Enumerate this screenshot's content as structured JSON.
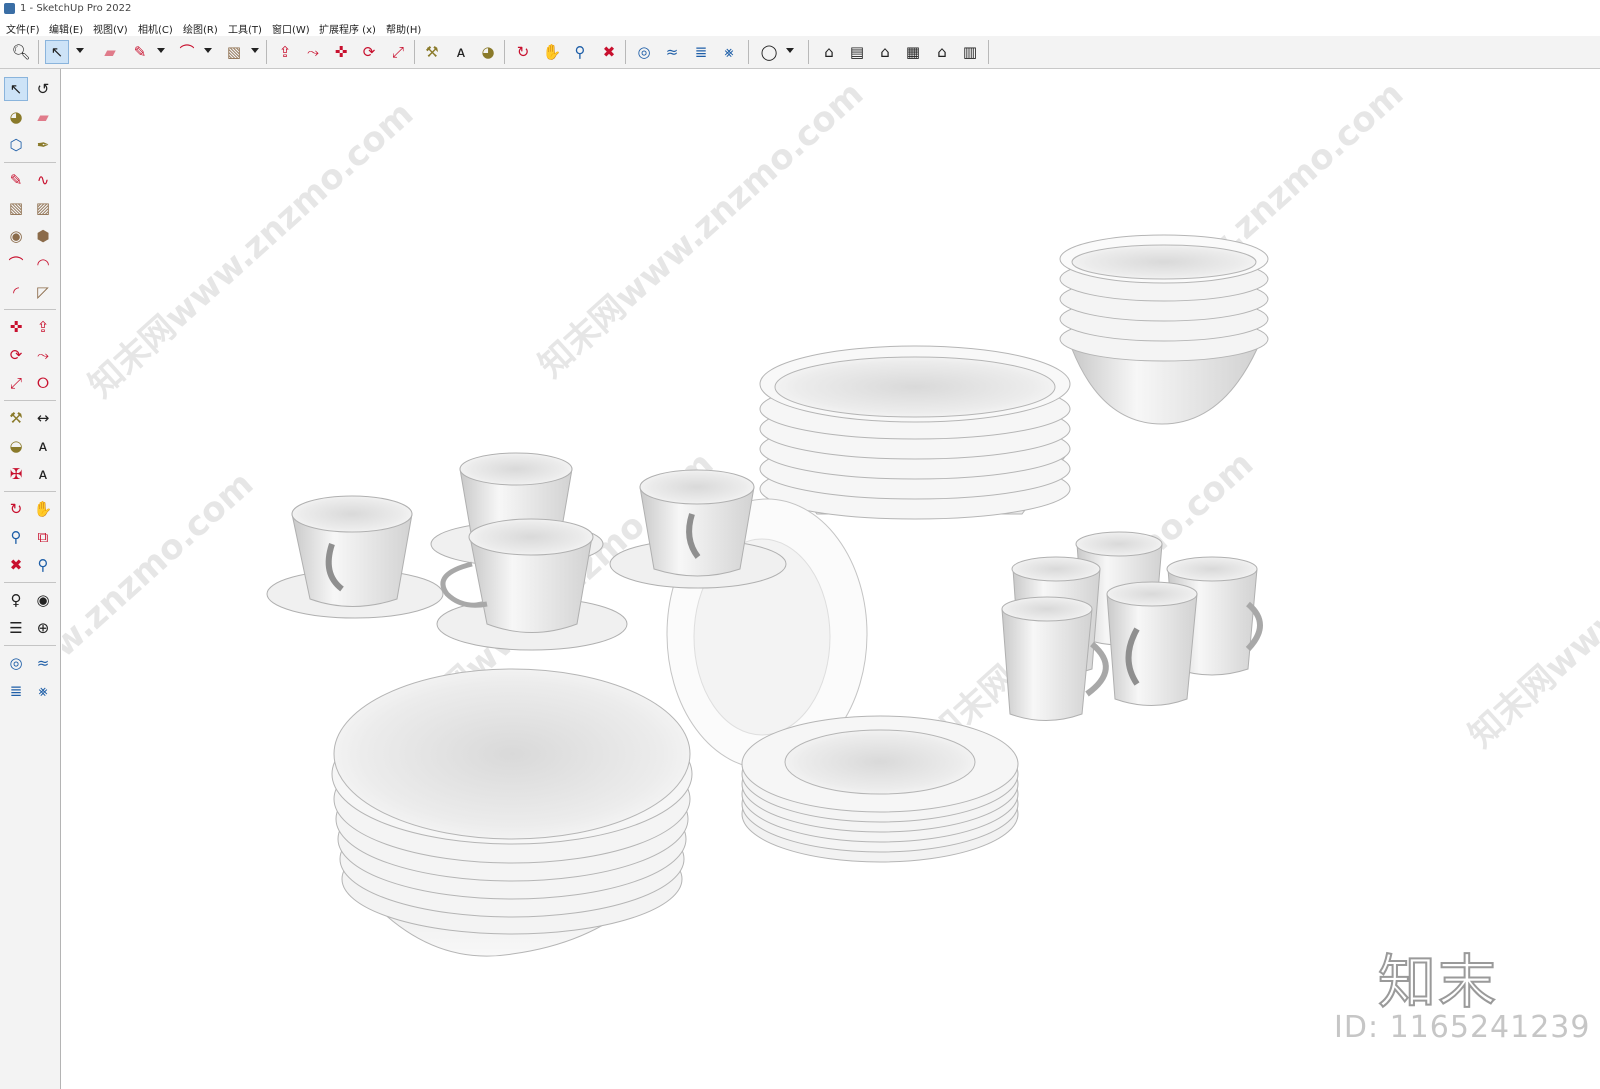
{
  "window": {
    "title": "1 - SketchUp Pro 2022"
  },
  "menu": {
    "items": [
      "文件(F)",
      "编辑(E)",
      "视图(V)",
      "相机(C)",
      "绘图(R)",
      "工具(T)",
      "窗口(W)",
      "扩展程序 (x)",
      "帮助(H)"
    ]
  },
  "toolbar": {
    "tools": [
      {
        "icon": "zoom-icon"
      },
      {
        "icon": "select-icon"
      },
      {
        "icon": "eraser-icon"
      },
      {
        "icon": "pencil-icon"
      },
      {
        "icon": "arc-icon"
      },
      {
        "icon": "rectangle-icon"
      },
      {
        "icon": "push-pull-icon"
      },
      {
        "icon": "follow-me-icon"
      },
      {
        "icon": "move-icon"
      },
      {
        "icon": "rotate-icon"
      },
      {
        "icon": "scale-icon"
      },
      {
        "icon": "tape-measure-icon"
      },
      {
        "icon": "text-icon"
      },
      {
        "icon": "paint-bucket-icon"
      },
      {
        "icon": "orbit-icon"
      },
      {
        "icon": "pan-icon"
      },
      {
        "icon": "zoom-window-icon"
      },
      {
        "icon": "zoom-extents-icon"
      },
      {
        "icon": "3d-warehouse-icon"
      },
      {
        "icon": "extension-warehouse-icon"
      },
      {
        "icon": "layout-icon"
      },
      {
        "icon": "extension-manager-icon"
      },
      {
        "icon": "account-icon"
      },
      {
        "icon": "iso-view-icon"
      },
      {
        "icon": "top-view-icon"
      },
      {
        "icon": "front-view-icon"
      },
      {
        "icon": "right-view-icon"
      },
      {
        "icon": "back-view-icon"
      },
      {
        "icon": "left-view-icon"
      }
    ]
  },
  "side_toolbar": {
    "tools": [
      "select-icon",
      "orbit-icon",
      "paint-bucket-icon",
      "eraser-icon",
      "component-icon",
      "tape-icon",
      "pencil-icon",
      "freehand-icon",
      "rectangle-icon",
      "rotated-rectangle-icon",
      "circle-icon",
      "polygon-icon",
      "arc-icon",
      "two-point-arc-icon",
      "three-point-arc-icon",
      "pie-icon",
      "move-icon",
      "push-pull-icon",
      "rotate-icon",
      "follow-me-icon",
      "scale-icon",
      "offset-icon",
      "tape-measure-icon",
      "dimension-icon",
      "protractor-icon",
      "text-icon",
      "axes-icon",
      "3d-text-icon",
      "orbit2-icon",
      "pan-icon",
      "zoom-icon",
      "zoom-window-icon",
      "zoom-extents-icon",
      "previous-view-icon",
      "position-camera-icon",
      "look-around-icon",
      "walk-icon",
      "section-plane-icon",
      "warehouse-icon",
      "extension-warehouse-icon",
      "layout-send-icon",
      "extension-manager-icon"
    ]
  },
  "watermarks": [
    "知末网www.znzmo.com"
  ],
  "brand": {
    "mark": "知末",
    "id": "ID: 1165241239"
  },
  "colors": {
    "toolbar_bg": "#f3f3f3",
    "viewport_bg": "#ffffff",
    "accent": "#cde3f7"
  }
}
